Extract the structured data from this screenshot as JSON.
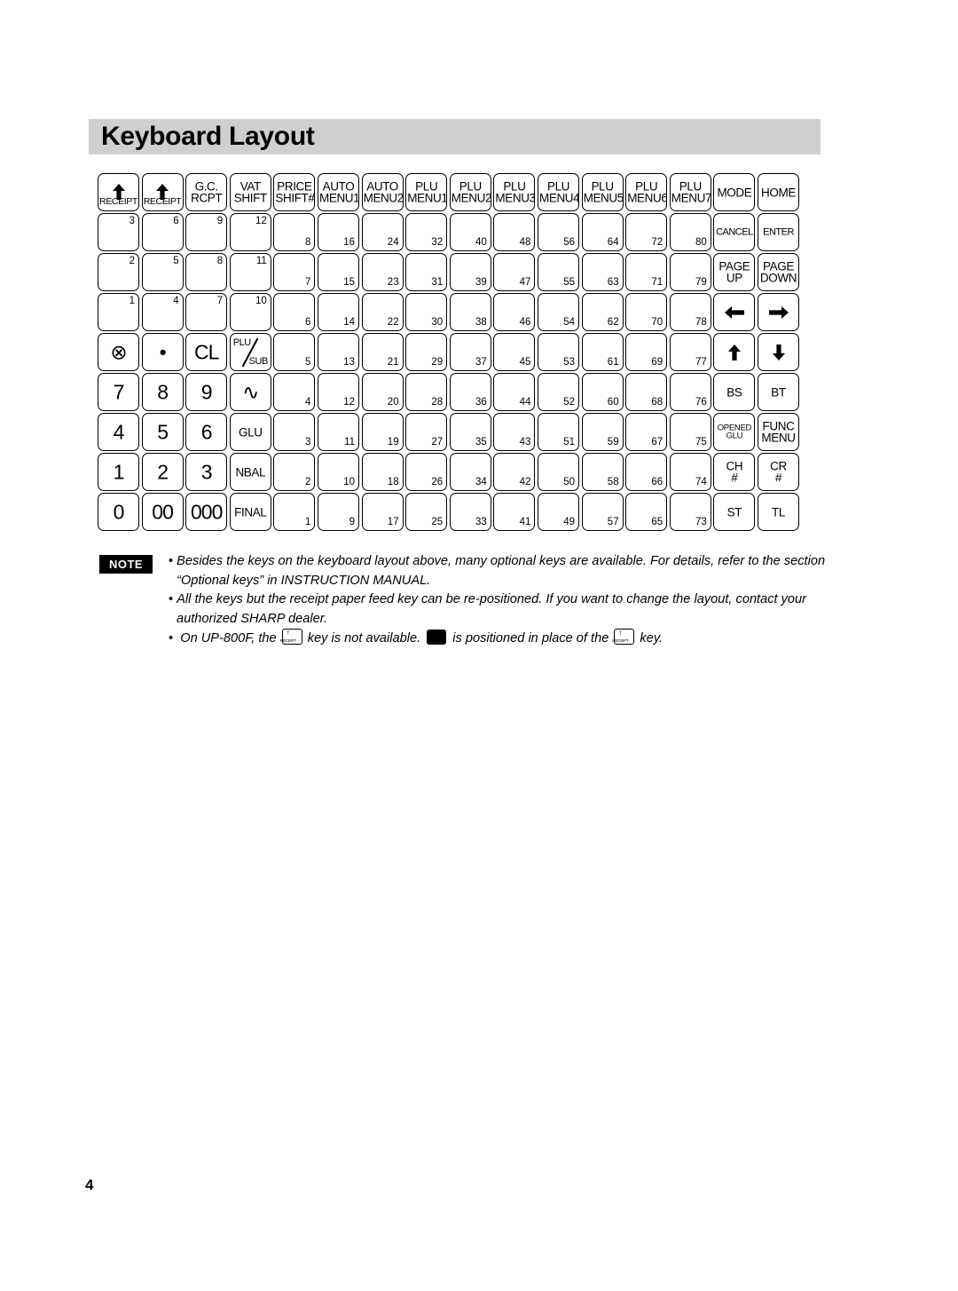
{
  "page": {
    "title": "Keyboard Layout",
    "page_number": "4"
  },
  "keyboard": {
    "columns": [
      {
        "name": "col-receipt-1",
        "header": {
          "icon": "up-arrow-icon",
          "label": "RECEIPT",
          "type": "receipt"
        },
        "blank_indices": [
          "3",
          "2",
          "1"
        ],
        "index_position": "top",
        "keys": [
          {
            "label": "⊗",
            "size": "big",
            "name": "multiply-key"
          },
          {
            "label": "7",
            "size": "big",
            "name": "digit-7-key"
          },
          {
            "label": "4",
            "size": "big",
            "name": "digit-4-key"
          },
          {
            "label": "1",
            "size": "big",
            "name": "digit-1-key"
          },
          {
            "label": "0",
            "size": "big",
            "name": "digit-0-key"
          }
        ]
      },
      {
        "name": "col-receipt-2",
        "header": {
          "icon": "up-arrow-icon",
          "label": "RECEIPT",
          "type": "receipt"
        },
        "blank_indices": [
          "6",
          "5",
          "4"
        ],
        "index_position": "top",
        "keys": [
          {
            "label": "•",
            "size": "big",
            "name": "decimal-point-key"
          },
          {
            "label": "8",
            "size": "big",
            "name": "digit-8-key"
          },
          {
            "label": "5",
            "size": "big",
            "name": "digit-5-key"
          },
          {
            "label": "2",
            "size": "big",
            "name": "digit-2-key"
          },
          {
            "label": "00",
            "size": "big",
            "name": "digit-00-key"
          }
        ]
      },
      {
        "name": "col-gc-rcpt",
        "header": {
          "lines": [
            "G.C.",
            "RCPT"
          ],
          "type": "text"
        },
        "blank_indices": [
          "9",
          "8",
          "7"
        ],
        "index_position": "top",
        "keys": [
          {
            "label": "CL",
            "size": "big",
            "name": "clear-key"
          },
          {
            "label": "9",
            "size": "big",
            "name": "digit-9-key"
          },
          {
            "label": "6",
            "size": "big",
            "name": "digit-6-key"
          },
          {
            "label": "3",
            "size": "big",
            "name": "digit-3-key"
          },
          {
            "label": "000",
            "size": "big",
            "name": "digit-000-key"
          }
        ]
      },
      {
        "name": "col-vat-shift",
        "header": {
          "lines": [
            "VAT",
            "SHIFT"
          ],
          "type": "text"
        },
        "blank_indices": [
          "12",
          "11",
          "10"
        ],
        "index_position": "top",
        "keys": [
          {
            "label": "PLU/SUB",
            "size": "plusub",
            "name": "plu-sub-key"
          },
          {
            "label": "∿",
            "size": "big",
            "name": "s-symbol-key"
          },
          {
            "label": "GLU",
            "size": "med",
            "name": "glu-key"
          },
          {
            "label": "NBAL",
            "size": "med",
            "name": "nbal-key"
          },
          {
            "label": "FINAL",
            "size": "med",
            "name": "final-key"
          }
        ]
      },
      {
        "name": "col-price-shift",
        "header": {
          "lines": [
            "PRICE",
            "SHIFT#"
          ],
          "type": "text"
        },
        "numbered": [
          "8",
          "7",
          "6",
          "5",
          "4",
          "3",
          "2",
          "1"
        ],
        "index_position": "bottom"
      },
      {
        "name": "col-auto-menu1",
        "header": {
          "lines": [
            "AUTO",
            "MENU1"
          ],
          "type": "text"
        },
        "numbered": [
          "16",
          "15",
          "14",
          "13",
          "12",
          "11",
          "10",
          "9"
        ],
        "index_position": "bottom"
      },
      {
        "name": "col-auto-menu2",
        "header": {
          "lines": [
            "AUTO",
            "MENU2"
          ],
          "type": "text"
        },
        "numbered": [
          "24",
          "23",
          "22",
          "21",
          "20",
          "19",
          "18",
          "17"
        ],
        "index_position": "bottom"
      },
      {
        "name": "col-plu-menu1",
        "header": {
          "lines": [
            "PLU",
            "MENU1"
          ],
          "type": "text"
        },
        "numbered": [
          "32",
          "31",
          "30",
          "29",
          "28",
          "27",
          "26",
          "25"
        ],
        "index_position": "bottom"
      },
      {
        "name": "col-plu-menu2",
        "header": {
          "lines": [
            "PLU",
            "MENU2"
          ],
          "type": "text"
        },
        "numbered": [
          "40",
          "39",
          "38",
          "37",
          "36",
          "35",
          "34",
          "33"
        ],
        "index_position": "bottom"
      },
      {
        "name": "col-plu-menu3",
        "header": {
          "lines": [
            "PLU",
            "MENU3"
          ],
          "type": "text"
        },
        "numbered": [
          "48",
          "47",
          "46",
          "45",
          "44",
          "43",
          "42",
          "41"
        ],
        "index_position": "bottom"
      },
      {
        "name": "col-plu-menu4",
        "header": {
          "lines": [
            "PLU",
            "MENU4"
          ],
          "type": "text"
        },
        "numbered": [
          "56",
          "55",
          "54",
          "53",
          "52",
          "51",
          "50",
          "49"
        ],
        "index_position": "bottom"
      },
      {
        "name": "col-plu-menu5",
        "header": {
          "lines": [
            "PLU",
            "MENU5"
          ],
          "type": "text"
        },
        "numbered": [
          "64",
          "63",
          "62",
          "61",
          "60",
          "59",
          "58",
          "57"
        ],
        "index_position": "bottom"
      },
      {
        "name": "col-plu-menu6",
        "header": {
          "lines": [
            "PLU",
            "MENU6"
          ],
          "type": "text"
        },
        "numbered": [
          "72",
          "71",
          "70",
          "69",
          "68",
          "67",
          "66",
          "65"
        ],
        "index_position": "bottom"
      },
      {
        "name": "col-plu-menu7",
        "header": {
          "lines": [
            "PLU",
            "MENU7"
          ],
          "type": "text"
        },
        "numbered": [
          "80",
          "79",
          "78",
          "77",
          "76",
          "75",
          "74",
          "73"
        ],
        "index_position": "bottom"
      },
      {
        "name": "col-mode",
        "header": {
          "lines": [
            "MODE"
          ],
          "type": "text"
        },
        "keys": [
          {
            "label": "CANCEL",
            "size": "sm",
            "name": "cancel-key"
          },
          {
            "lines": [
              "PAGE",
              "UP"
            ],
            "size": "med",
            "name": "page-up-key"
          },
          {
            "label": "←",
            "size": "glyph",
            "name": "arrow-left-key"
          },
          {
            "label": "↑",
            "size": "glyph",
            "name": "arrow-up-key"
          },
          {
            "label": "BS",
            "size": "med",
            "name": "bs-key"
          },
          {
            "lines": [
              "OPENED",
              "GLU"
            ],
            "size": "xs",
            "name": "opened-glu-key"
          },
          {
            "lines": [
              "CH",
              "#"
            ],
            "size": "med",
            "name": "ch-number-key"
          },
          {
            "label": "ST",
            "size": "med",
            "name": "st-key"
          }
        ]
      },
      {
        "name": "col-home",
        "header": {
          "lines": [
            "HOME"
          ],
          "type": "text"
        },
        "keys": [
          {
            "label": "ENTER",
            "size": "sm",
            "name": "enter-key"
          },
          {
            "lines": [
              "PAGE",
              "DOWN"
            ],
            "size": "med",
            "name": "page-down-key"
          },
          {
            "label": "→",
            "size": "glyph",
            "name": "arrow-right-key"
          },
          {
            "label": "↓",
            "size": "glyph",
            "name": "arrow-down-key"
          },
          {
            "label": "BT",
            "size": "med",
            "name": "bt-key"
          },
          {
            "lines": [
              "FUNC",
              "MENU"
            ],
            "size": "med",
            "name": "func-menu-key"
          },
          {
            "lines": [
              "CR",
              "#"
            ],
            "size": "med",
            "name": "cr-number-key"
          },
          {
            "label": "TL",
            "size": "med",
            "name": "tl-key"
          }
        ]
      }
    ]
  },
  "note": {
    "badge": "NOTE",
    "items": [
      "Besides the keys on the keyboard layout above, many optional keys are available. For details, refer to the section “Optional keys” in INSTRUCTION MANUAL.",
      "All the keys but the receipt paper feed key can be re-positioned. If you want to change the layout, contact your authorized SHARP dealer.",
      "On UP-800F, the [RECEIPT] key is not available. [black key] is positioned in place of the [RECEIPT] key."
    ],
    "item3": {
      "part1": "On UP-800F, the",
      "part2": "key is not available.",
      "part3": "is positioned in place of the",
      "part4": "key.",
      "inline_key_label": "RECEIPT"
    }
  }
}
